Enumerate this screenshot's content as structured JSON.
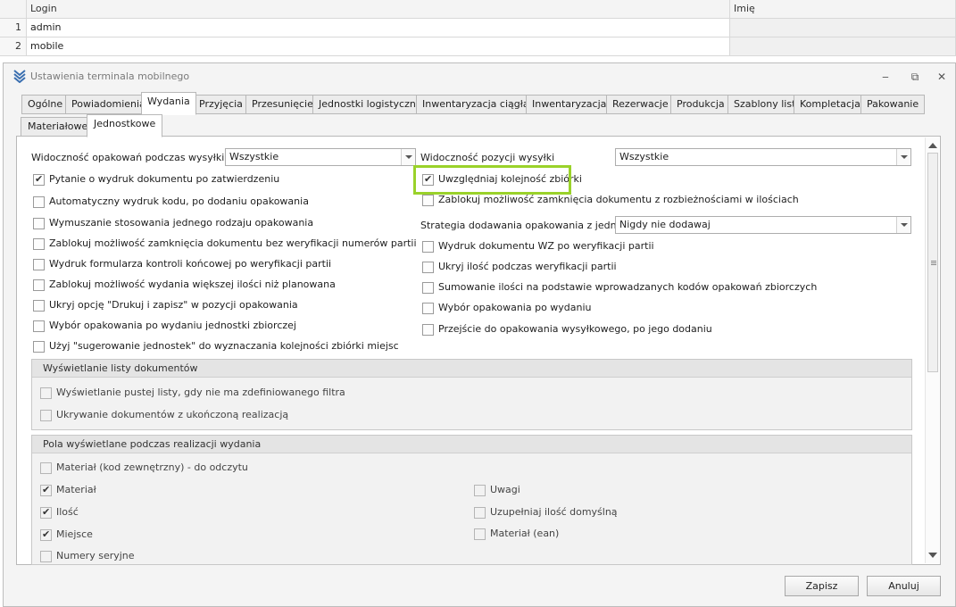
{
  "grid": {
    "headers": [
      "Login",
      "Imię"
    ],
    "rows": [
      {
        "num": "1",
        "login": "admin",
        "imie": ""
      },
      {
        "num": "2",
        "login": "mobile",
        "imie": ""
      }
    ]
  },
  "dialog": {
    "title": "Ustawienia terminala mobilnego",
    "window_buttons": {
      "minimize": "‒",
      "restore": "⧉",
      "close": "✕"
    },
    "tabs": [
      "Ogólne",
      "Powiadomienia",
      "Wydania",
      "Przyjęcia",
      "Przesunięcie",
      "Jednostki logistyczne",
      "Inwentaryzacja ciągła",
      "Inwentaryzacja",
      "Rezerwacje",
      "Produkcja",
      "Szablony list",
      "Kompletacja",
      "Pakowanie"
    ],
    "active_tab": "Wydania",
    "subtabs": [
      "Materiałowe",
      "Jednostkowe"
    ],
    "active_subtab": "Jednostkowe",
    "left": {
      "visibility_label": "Widoczność opakowań podczas wysyłki",
      "visibility_value": "Wszystkie",
      "checks": [
        {
          "label": "Pytanie o wydruk dokumentu po zatwierdzeniu",
          "checked": true
        },
        {
          "label": "Automatyczny wydruk kodu, po dodaniu opakowania",
          "checked": false
        },
        {
          "label": "Wymuszanie stosowania jednego rodzaju opakowania",
          "checked": false
        },
        {
          "label": "Zablokuj możliwość zamknięcia dokumentu bez weryfikacji numerów partii",
          "checked": false
        },
        {
          "label": "Wydruk formularza kontroli końcowej po weryfikacji partii",
          "checked": false
        },
        {
          "label": "Zablokuj możliwość wydania większej ilości niż planowana",
          "checked": false
        },
        {
          "label": "Ukryj opcję \"Drukuj i zapisz\" w pozycji opakowania",
          "checked": false
        },
        {
          "label": "Wybór opakowania po wydaniu jednostki zbiorczej",
          "checked": false
        },
        {
          "label": "Użyj \"sugerowanie jednostek\" do wyznaczania kolejności zbiórki miejsc",
          "checked": false
        }
      ]
    },
    "right": {
      "visibility_label": "Widoczność pozycji wysyłki",
      "visibility_value": "Wszystkie",
      "checks_top": [
        {
          "label": "Uwzględniaj kolejność zbiórki",
          "checked": true
        },
        {
          "label": "Zablokuj możliwość zamknięcia dokumentu z rozbieżnościami w ilościach",
          "checked": false
        }
      ],
      "strategy_label": "Strategia dodawania opakowania z jednostki",
      "strategy_value": "Nigdy nie dodawaj",
      "checks_bottom": [
        {
          "label": "Wydruk dokumentu WZ po weryfikacji partii",
          "checked": false
        },
        {
          "label": "Ukryj ilość podczas weryfikacji partii",
          "checked": false
        },
        {
          "label": "Sumowanie ilości na podstawie wprowadzanych kodów opakowań zbiorczych",
          "checked": false
        },
        {
          "label": "Wybór opakowania po wydaniu",
          "checked": false
        },
        {
          "label": "Przejście do opakowania wysyłkowego, po jego dodaniu",
          "checked": false
        }
      ]
    },
    "group_docs": {
      "title": "Wyświetlanie listy dokumentów",
      "checks": [
        {
          "label": "Wyświetlanie pustej listy, gdy nie ma zdefiniowanego filtra",
          "checked": false
        },
        {
          "label": "Ukrywanie dokumentów z ukończoną realizacją",
          "checked": false
        }
      ]
    },
    "group_fields": {
      "title": "Pola wyświetlane podczas realizacji wydania",
      "left": [
        {
          "label": "Materiał (kod zewnętrzny) - do odczytu",
          "checked": false
        },
        {
          "label": "Materiał",
          "checked": true
        },
        {
          "label": "Ilość",
          "checked": true
        },
        {
          "label": "Miejsce",
          "checked": true
        },
        {
          "label": "Numery seryjne",
          "checked": false
        }
      ],
      "right": [
        {
          "label": "Uwagi",
          "checked": false
        },
        {
          "label": "Uzupełniaj ilość domyślną",
          "checked": false
        },
        {
          "label": "Materiał (ean)",
          "checked": false
        }
      ]
    },
    "buttons": {
      "save": "Zapisz",
      "cancel": "Anuluj"
    },
    "colors": {
      "highlight": "#9ad22a",
      "dialog_bg": "#f4f4f4",
      "panel_bg": "#ffffff"
    }
  }
}
